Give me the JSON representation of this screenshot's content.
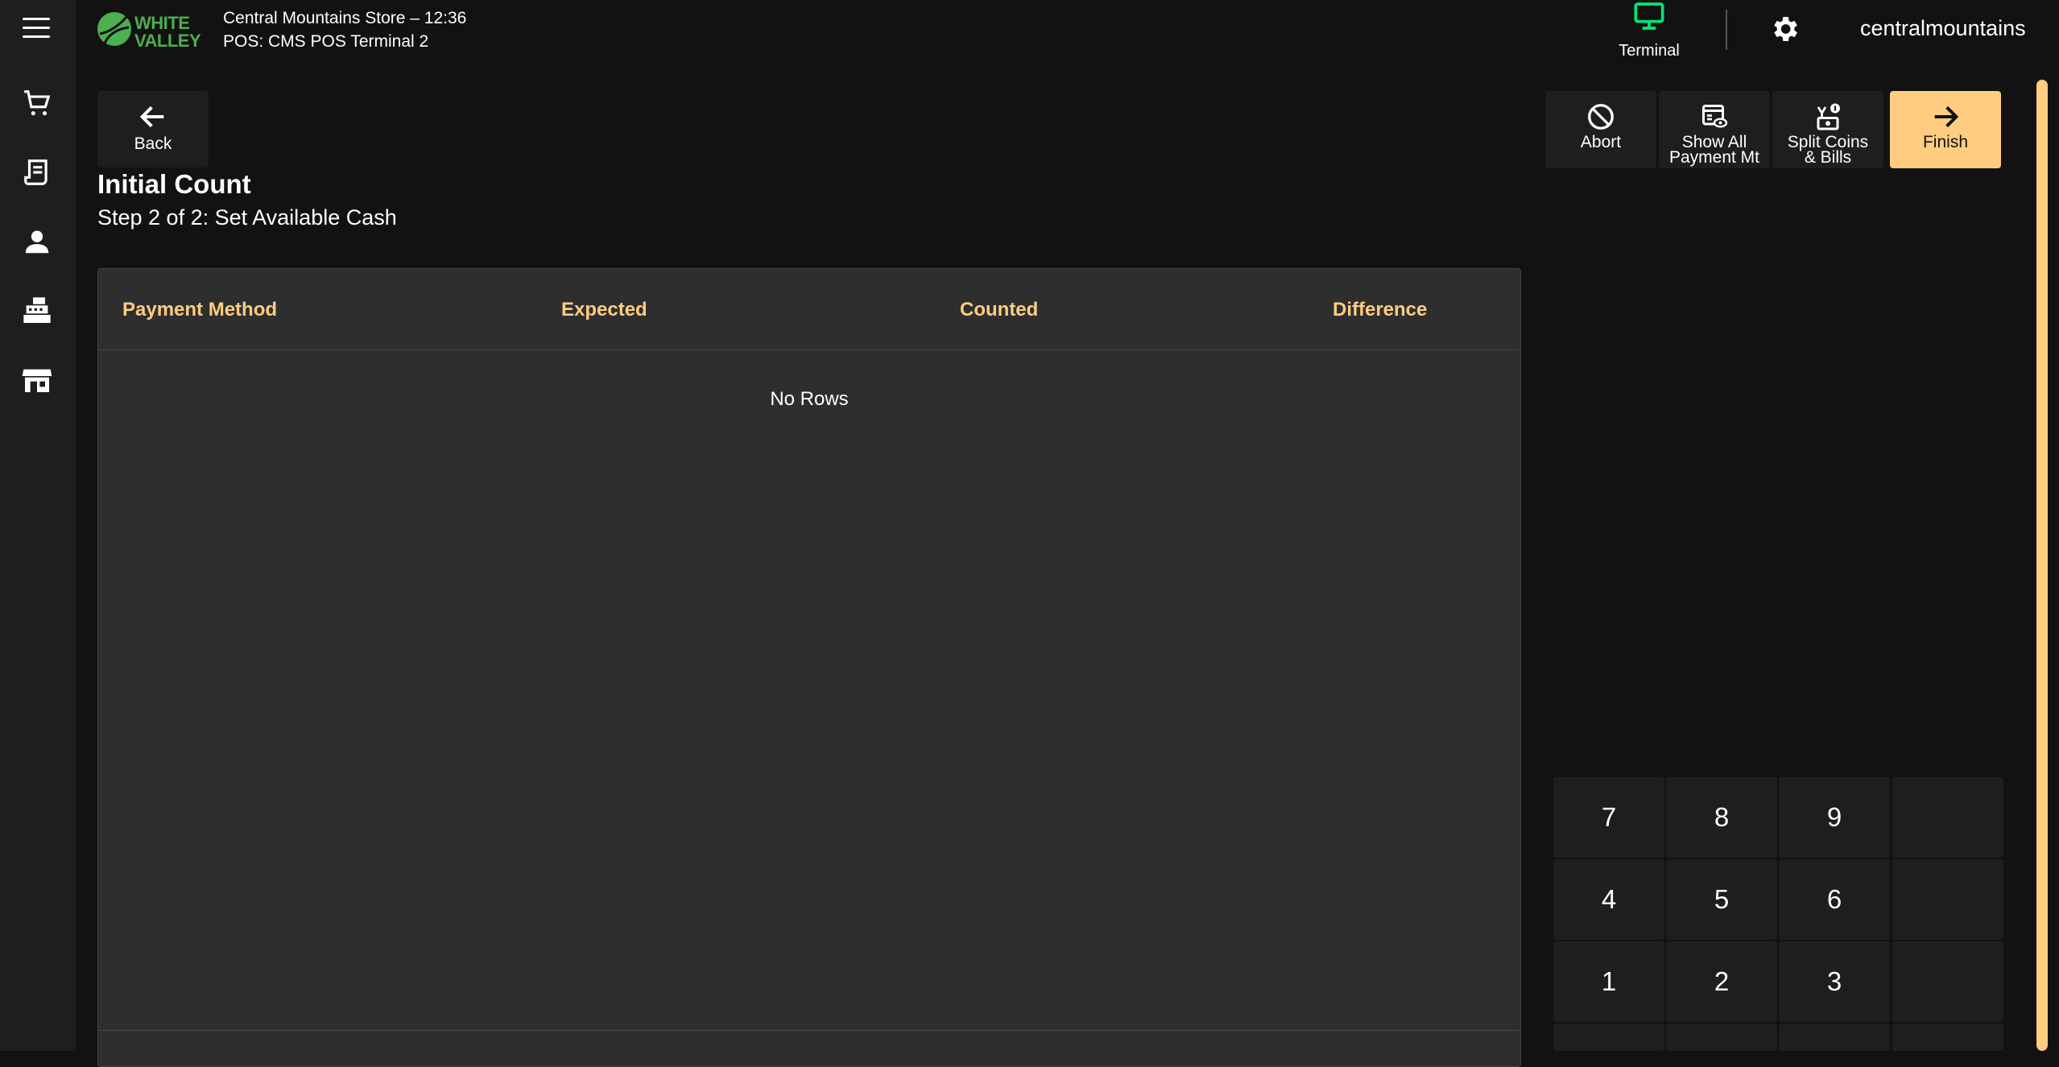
{
  "header": {
    "logo_text": [
      "WHITE",
      "VALLEY"
    ],
    "store_line": "Central Mountains Store – 12:36",
    "pos_line": "POS: CMS POS Terminal 2",
    "terminal_label": "Terminal",
    "username": "centralmountains"
  },
  "sidebar": {
    "items": [
      {
        "icon": "cart-icon"
      },
      {
        "icon": "receipt-icon"
      },
      {
        "icon": "person-icon"
      },
      {
        "icon": "cash-register-icon"
      },
      {
        "icon": "store-icon"
      }
    ]
  },
  "page": {
    "back_label": "Back",
    "title": "Initial Count",
    "subtitle": "Step 2 of 2: Set Available Cash"
  },
  "table": {
    "columns": [
      "Payment Method",
      "Expected",
      "Counted",
      "Difference"
    ],
    "empty_text": "No Rows"
  },
  "actions": {
    "abort": "Abort",
    "show_all_1": "Show All",
    "show_all_2": "Payment Mt",
    "split_1": "Split Coins",
    "split_2": "& Bills",
    "finish": "Finish"
  },
  "numpad": {
    "keys": [
      "7",
      "8",
      "9",
      "",
      "4",
      "5",
      "6",
      "",
      "1",
      "2",
      "3",
      ""
    ]
  },
  "colors": {
    "accent": "#ffcc80",
    "brand_green": "#4caf50",
    "terminal_green": "#00e676"
  }
}
